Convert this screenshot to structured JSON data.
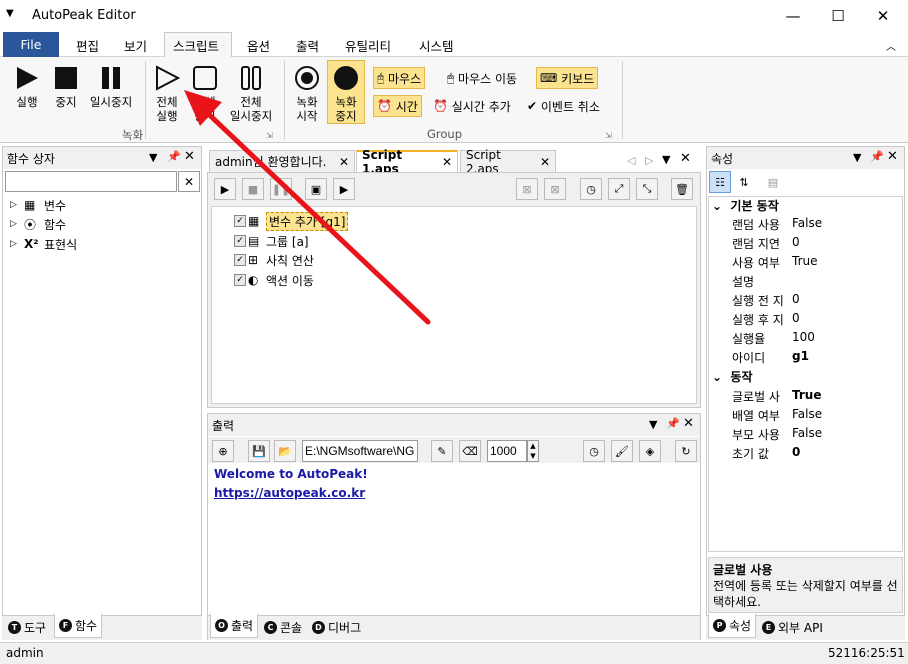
{
  "window": {
    "title": "AutoPeak Editor",
    "minimize": "—",
    "maximize": "☐",
    "close": "✕"
  },
  "menu": {
    "file": "File",
    "items": [
      "편집",
      "보기",
      "스크립트",
      "옵션",
      "출력",
      "유틸리티",
      "시스템"
    ]
  },
  "ribbon": {
    "run": "실행",
    "stop": "중지",
    "pause": "일시중지",
    "run_all_1": "전체",
    "run_all_2": "실행",
    "stop_all_1": "전체",
    "stop_all_2": "중지",
    "pause_all_1": "전체",
    "pause_all_2": "일시중지",
    "rec_start_1": "녹화",
    "rec_start_2": "시작",
    "rec_stop_1": "녹화",
    "rec_stop_2": "중지",
    "mouse": "마우스",
    "mouse_move": "마우스 이동",
    "keyboard": "키보드",
    "time": "시간",
    "realtime_add": "실시간 추가",
    "event_cancel": "이벤트 취소",
    "group_record": "녹화",
    "group_group": "Group"
  },
  "left_panel": {
    "title": "함수 상자",
    "search_value": "",
    "items": [
      {
        "label": "변수",
        "icon": "variable-icon"
      },
      {
        "label": "함수",
        "icon": "function-icon"
      },
      {
        "label": "표현식",
        "icon": "expression-icon"
      }
    ],
    "tabs": [
      {
        "key": "T",
        "label": "도구"
      },
      {
        "key": "F",
        "label": "함수"
      }
    ]
  },
  "editor": {
    "tabs": [
      {
        "label": "admin님 환영합니다.",
        "active": false
      },
      {
        "label": "Script 1.aps",
        "active": true
      },
      {
        "label": "Script 2.aps",
        "active": false
      }
    ],
    "tree": [
      {
        "label": "변수 추가 [g1]",
        "selected": true
      },
      {
        "label": "그룹 [a]",
        "selected": false
      },
      {
        "label": "사칙 연산",
        "selected": false
      },
      {
        "label": "액션 이동",
        "selected": false
      }
    ]
  },
  "output": {
    "title": "출력",
    "path": "E:\\NGMsoftware\\NG",
    "count": "1000",
    "lines": [
      "Welcome to AutoPeak!",
      "https://autopeak.co.kr"
    ],
    "tabs": [
      {
        "key": "O",
        "label": "출력"
      },
      {
        "key": "C",
        "label": "콘솔"
      },
      {
        "key": "D",
        "label": "디버그"
      }
    ]
  },
  "properties": {
    "title": "속성",
    "sections": [
      {
        "name": "기본 동작",
        "rows": [
          {
            "key": "랜덤 사용",
            "value": "False",
            "bold": false
          },
          {
            "key": "랜덤 지연",
            "value": "0",
            "bold": false
          },
          {
            "key": "사용 여부",
            "value": "True",
            "bold": false
          },
          {
            "key": "설명",
            "value": "",
            "bold": false
          },
          {
            "key": "실행 전 지",
            "value": "0",
            "bold": false
          },
          {
            "key": "실행 후 지",
            "value": "0",
            "bold": false
          },
          {
            "key": "실행율",
            "value": "100",
            "bold": false
          },
          {
            "key": "아이디",
            "value": "g1",
            "bold": true
          }
        ]
      },
      {
        "name": "동작",
        "rows": [
          {
            "key": "글로벌 사",
            "value": "True",
            "bold": true
          },
          {
            "key": "배열 여부",
            "value": "False",
            "bold": false
          },
          {
            "key": "부모 사용",
            "value": "False",
            "bold": false
          },
          {
            "key": "초기 값",
            "value": "0",
            "bold": true
          }
        ]
      }
    ],
    "desc_title": "글로벌 사용",
    "desc_text": "전역에 등록 또는 삭제할지 여부를 선택하세요.",
    "tabs": [
      {
        "key": "P",
        "label": "속성"
      },
      {
        "key": "E",
        "label": "외부 API"
      }
    ]
  },
  "status": {
    "user": "admin",
    "time": "52116:25:51"
  }
}
